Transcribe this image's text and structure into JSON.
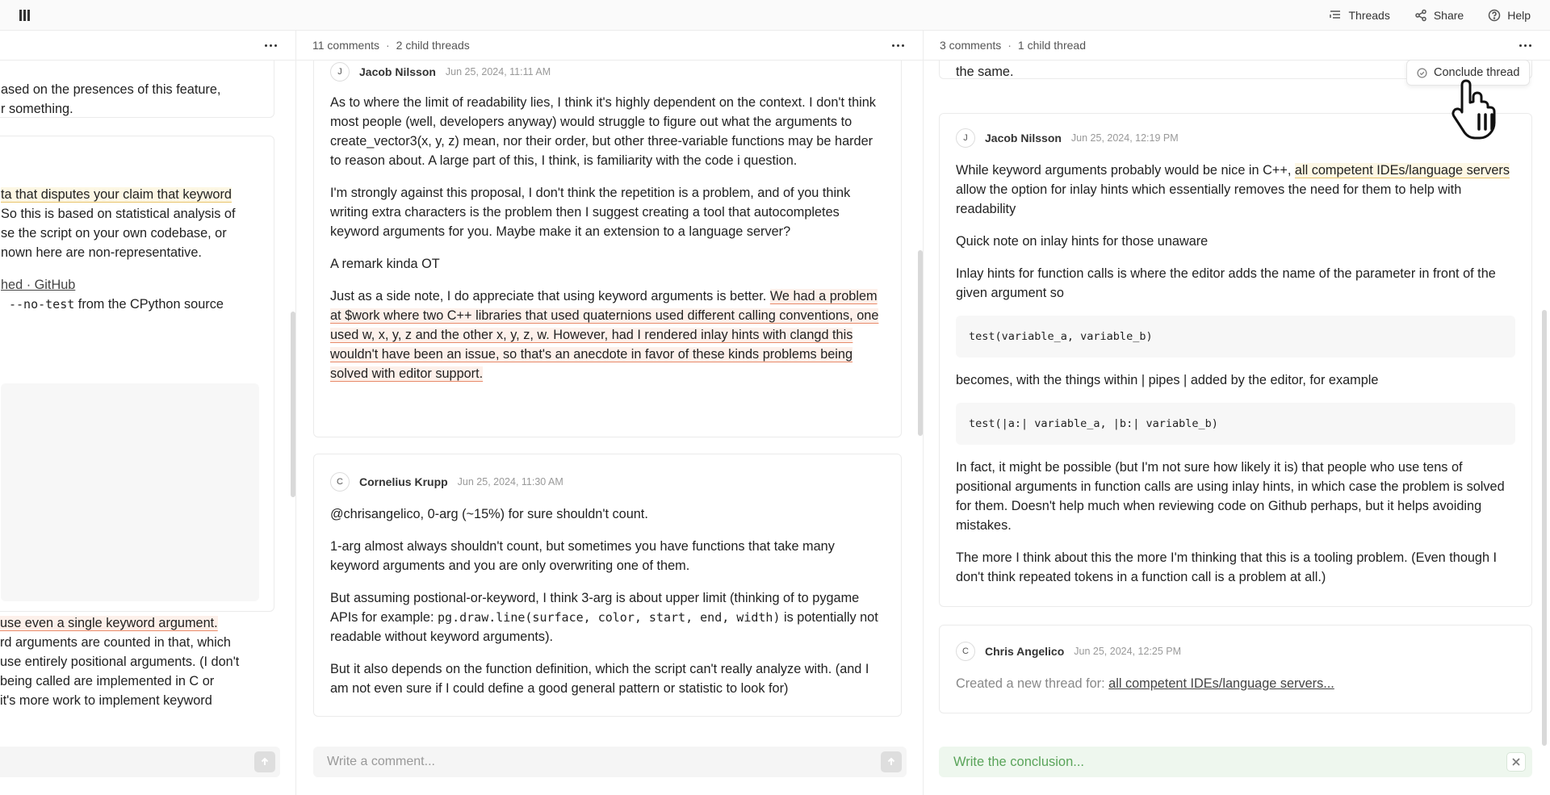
{
  "topbar": {
    "threads_label": "Threads",
    "share_label": "Share",
    "help_label": "Help"
  },
  "left": {
    "card1_lines": [
      "ased on the presences of this feature,",
      "r something."
    ],
    "card2_lines": [
      "ta that disputes your claim that keyword",
      "So this is based on statistical analysis of",
      "se the script on your own codebase, or",
      "nown here are non-representative."
    ],
    "link_text": "hed · GitHub",
    "mono_text": "--no-test",
    "mono_suffix": " from the CPython source",
    "bottom_highlight": "use even a single keyword argument.",
    "bottom_lines": [
      "rd arguments are counted in that, which",
      "use entirely positional arguments. (I don't",
      "being called are implemented in C or",
      "it's more work to implement keyword"
    ]
  },
  "middle": {
    "comments_count": "11 comments",
    "child_threads": "2 child threads",
    "comment1": {
      "avatar": "J",
      "author": "Jacob Nilsson",
      "date": "Jun 25, 2024, 11:11 AM",
      "p1": "As to where the limit of readability lies, I think it's highly dependent on the context. I don't think most people (well, developers anyway) would struggle to figure out what the arguments to create_vector3(x, y, z) mean, nor their order, but other three-variable functions may be harder to reason about. A large part of this, I think, is familiarity with the code i question.",
      "p2": "I'm strongly against this proposal, I don't think the repetition is a problem, and of you think writing extra characters is the problem then I suggest creating a tool that autocompletes keyword arguments for you. Maybe make it an extension to a language server?",
      "p3": " A remark kinda OT",
      "p4_plain": "Just as a side note, I do appreciate that using keyword arguments is better. ",
      "p4_highlight": "We had a problem at $work where two C++ libraries that used quaternions used different calling conventions, one used w, x, y, z and the other x, y, z, w. However, had I rendered inlay hints with clangd this wouldn't have been an issue, so that's an anecdote in favor of these kinds problems being solved with editor support."
    },
    "comment2": {
      "avatar": "C",
      "author": "Cornelius Krupp",
      "date": "Jun 25, 2024, 11:30 AM",
      "p1": "@chrisangelico, 0-arg (~15%) for sure shouldn't count.",
      "p2": "1-arg almost always shouldn't count, but sometimes you have functions that take many keyword arguments and you are only overwriting one of them.",
      "p3_a": "But assuming postional-or-keyword, I think 3-arg is about upper limit (thinking of to pygame APIs for example: ",
      "p3_code": "pg.draw.line(surface, color, start, end, width)",
      "p3_b": " is potentially not readable without keyword arguments).",
      "p4": "But it also depends on the function definition, which the script can't really analyze with. (and I am not even sure if I could define a good general pattern or statistic to look for)"
    },
    "composer_placeholder": "Write a comment..."
  },
  "right": {
    "comments_count": "3 comments",
    "child_threads": "1 child thread",
    "top_fragment": "the same.",
    "conclude_label": "Conclude thread",
    "comment1": {
      "avatar": "J",
      "author": "Jacob Nilsson",
      "date": "Jun 25, 2024, 12:19 PM",
      "p1_a": "While keyword arguments probably would be nice in C++, ",
      "p1_hl": "all competent IDEs/language servers",
      "p1_b": " allow the option for inlay hints which essentially removes the need for them to help with readability",
      "p2": " Quick note on inlay hints for those unaware",
      "p3": "Inlay hints for function calls is where the editor adds the name of the parameter in front of the given argument so",
      "code1": "test(variable_a, variable_b)",
      "p4": "becomes, with the things within  | pipes |  added by the editor, for example",
      "code2": "test(|a:| variable_a, |b:| variable_b)",
      "p5": "In fact, it might be possible (but I'm not sure how likely it is) that people who use tens of positional arguments in function calls are using inlay hints, in which case the problem is solved for them. Doesn't help much when reviewing code on Github perhaps, but it helps avoiding mistakes.",
      "p6": "The more I think about this the more I'm thinking that this is a tooling problem. (Even though I don't think repeated tokens in a function call is a problem at all.)"
    },
    "comment2": {
      "avatar": "C",
      "author": "Chris Angelico",
      "date": "Jun 25, 2024, 12:25 PM",
      "created_text": "Created a new thread for: ",
      "created_link": "all competent IDEs/language servers..."
    },
    "conclusion_placeholder": "Write the conclusion..."
  }
}
